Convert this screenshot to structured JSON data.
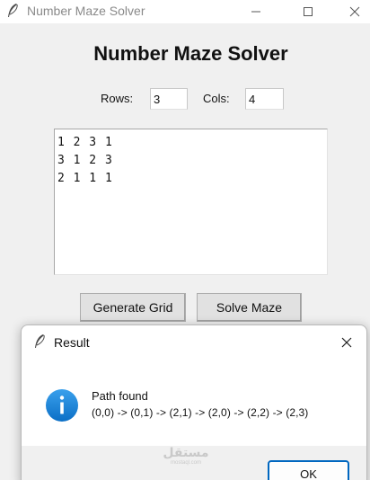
{
  "main_window": {
    "title": "Number Maze Solver",
    "heading": "Number Maze Solver",
    "rows_label": "Rows:",
    "rows_value": "3",
    "cols_label": "Cols:",
    "cols_value": "4",
    "grid_lines": [
      "1 2 3 1",
      "3 1 2 3",
      "2 1 1 1"
    ],
    "generate_button": "Generate Grid",
    "solve_button": "Solve Maze"
  },
  "dialog": {
    "title": "Result",
    "icon": "info-icon",
    "message_title": "Path found",
    "message_body": "(0,0) -> (0,1) -> (2,1) -> (2,0) -> (2,2) -> (2,3)",
    "ok_button": "OK"
  },
  "watermark": {
    "arabic": "مستقل",
    "latin": "mostaql.com"
  },
  "colors": {
    "accent": "#0067c0",
    "info_icon": "#1a7fd4",
    "window_bg": "#f0f0f0"
  }
}
